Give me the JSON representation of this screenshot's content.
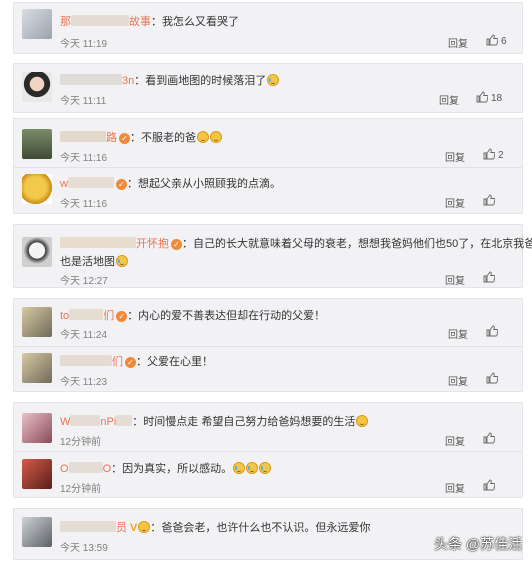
{
  "watermark": "头条 @苏佳活",
  "comments": [
    {
      "name_partial": "那",
      "name_tail": "故事",
      "text": "：我怎么又看哭了",
      "time": "今天 11:19",
      "reply": "回复",
      "likes": "6",
      "emoji": []
    },
    {
      "name_partial": "",
      "name_tail": "3n",
      "text": "：看到画地图的时候落泪了",
      "time": "今天 11:11",
      "reply": "回复",
      "likes": "18",
      "emoji": [
        "cry"
      ]
    },
    {
      "name_partial": "",
      "name_tail": "路",
      "text": "：不服老的爸",
      "time": "今天 11:16",
      "reply": "回复",
      "likes": "2",
      "emoji": [
        "smile",
        "smile"
      ],
      "badge": true
    },
    {
      "name_partial": "w",
      "name_tail": "",
      "text": "：想起父亲从小照顾我的点滴。",
      "time": "今天 11:16",
      "reply": "回复",
      "likes": "",
      "emoji": [],
      "badge": true
    },
    {
      "name_partial": "",
      "name_tail": "开怀抱",
      "text": "：自己的长大就意味着父母的衰老，想想我爸妈他们也50了，在北京我爸",
      "text2": "也是活地图",
      "time": "今天 12:27",
      "reply": "回复",
      "likes": "",
      "emoji": [
        "cry"
      ],
      "badge": true
    },
    {
      "name_partial": "to",
      "name_tail": "们",
      "text": "：内心的爱不善表达但却在行动的父爱！",
      "time": "今天 11:24",
      "reply": "回复",
      "likes": "",
      "emoji": [],
      "badge": true
    },
    {
      "name_partial": "",
      "name_tail": "们",
      "text": "：父爱在心里！",
      "time": "今天 11:23",
      "reply": "回复",
      "likes": "",
      "emoji": [],
      "badge": true
    },
    {
      "name_partial": "W",
      "name_tail": "nPi",
      "text": "：时间慢点走 希望自己努力给爸妈想要的生活",
      "time": "12分钟前",
      "reply": "回复",
      "likes": "",
      "emoji": [
        "smile"
      ]
    },
    {
      "name_partial": "O",
      "name_tail": "O",
      "text": "：因为真实，所以感动。",
      "time": "12分钟前",
      "reply": "回复",
      "likes": "",
      "emoji": [
        "cry",
        "cry",
        "cry"
      ]
    },
    {
      "name_partial": "",
      "name_tail": "员",
      "text": "：爸爸会老，也许什么也不认识。但永远爱你",
      "time": "今天 13:59",
      "reply": "",
      "likes": "",
      "emoji": [],
      "badge": true,
      "vip": "V"
    }
  ]
}
